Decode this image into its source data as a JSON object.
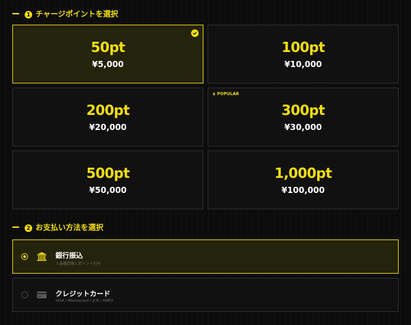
{
  "sections": {
    "charge": {
      "number": "1",
      "title": "チャージポイントを選択"
    },
    "payment": {
      "number": "2",
      "title": "お支払い方法を選択"
    }
  },
  "options": [
    {
      "points": "50pt",
      "price": "¥5,000",
      "selected": true
    },
    {
      "points": "100pt",
      "price": "¥10,000",
      "selected": false
    },
    {
      "points": "200pt",
      "price": "¥20,000",
      "selected": false
    },
    {
      "points": "300pt",
      "price": "¥30,000",
      "selected": false,
      "badge": "POPULAR"
    },
    {
      "points": "500pt",
      "price": "¥50,000",
      "selected": false
    },
    {
      "points": "1,000pt",
      "price": "¥100,000",
      "selected": false
    }
  ],
  "payment_methods": [
    {
      "title": "銀行振込",
      "subtitle": "入金確認後にポイント付与",
      "icon": "bank-icon",
      "selected": true
    },
    {
      "title": "クレジットカード",
      "subtitle": "VISA / Mastercard / JCB / AMEX",
      "icon": "credit-card-icon",
      "selected": false
    }
  ],
  "colors": {
    "accent": "#f2de13",
    "selected_bg": "#24230b",
    "card_bg": "#111111",
    "border": "#2e2e2e",
    "page_bg": "#0c0c0c"
  }
}
